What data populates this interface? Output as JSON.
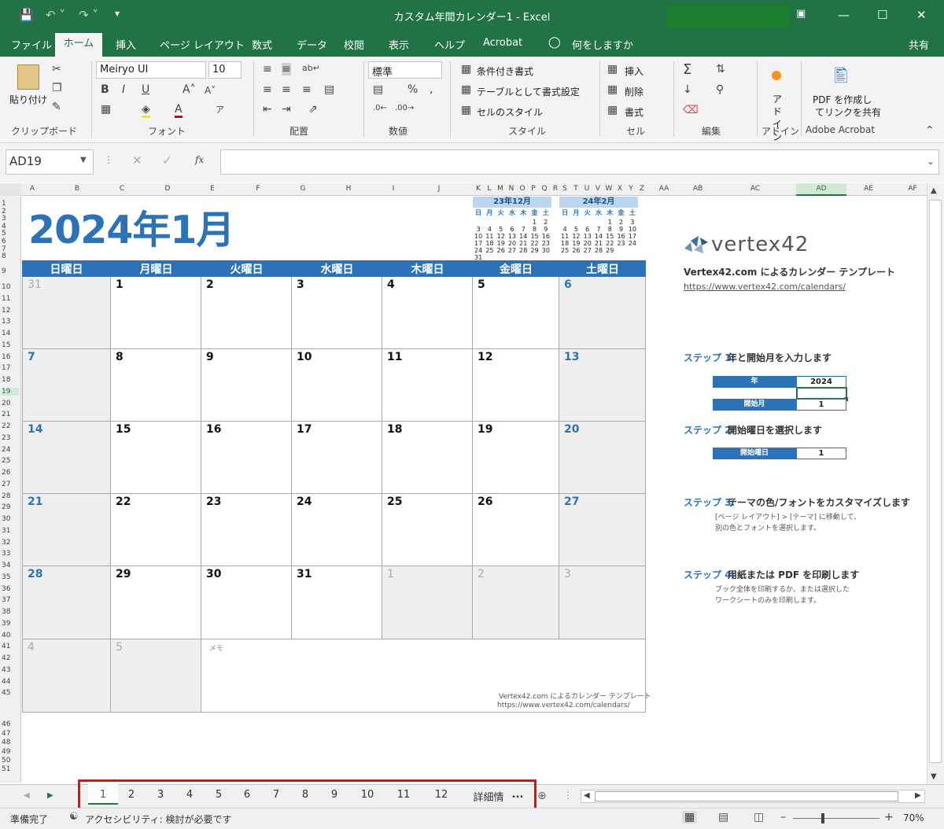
{
  "window": {
    "title": "カスタム年間カレンダー1  -  Excel",
    "quick_access": [
      "save-icon",
      "undo-icon",
      "redo-icon",
      "customize-icon"
    ],
    "controls": [
      "ribbon-display-icon",
      "minimize-icon",
      "maximize-icon",
      "close-icon"
    ]
  },
  "menu": {
    "tabs": [
      "ファイル",
      "ホーム",
      "挿入",
      "ページ レイアウト",
      "数式",
      "データ",
      "校閲",
      "表示",
      "ヘルプ",
      "Acrobat"
    ],
    "tell_me": "何をしますか",
    "share": "共有"
  },
  "ribbon": {
    "clipboard": {
      "paste": "貼り付け",
      "group": "クリップボード"
    },
    "font": {
      "name": "Meiryo UI",
      "size": "10",
      "group": "フォント"
    },
    "alignment": {
      "group": "配置"
    },
    "number": {
      "format": "標準",
      "group": "数値"
    },
    "styles": {
      "conditional": "条件付き書式",
      "table": "テーブルとして書式設定",
      "cell_styles": "セルのスタイル",
      "group": "スタイル"
    },
    "cells": {
      "insert": "挿入",
      "delete": "削除",
      "format": "書式",
      "group": "セル"
    },
    "editing": {
      "group": "編集"
    },
    "addins": {
      "label": "アド\nイン",
      "group": "アドイン"
    },
    "acrobat": {
      "label1": "PDF を作成し",
      "label2": "てリンクを共有",
      "group": "Adobe Acrobat"
    }
  },
  "formula_bar": {
    "name_box": "AD19",
    "fx": "fx",
    "content": ""
  },
  "columns": [
    "A",
    "B",
    "C",
    "D",
    "E",
    "F",
    "G",
    "H",
    "I",
    "J",
    "K",
    "L",
    "M",
    "N",
    "O",
    "P",
    "Q",
    "R",
    "S",
    "T",
    "U",
    "V",
    "W",
    "X",
    "Y",
    "Z",
    "AA",
    "AB",
    "AC",
    "AD",
    "AE",
    "AF"
  ],
  "rows": [
    "1",
    "2",
    "3",
    "4",
    "5",
    "6",
    "7",
    "8",
    "9",
    "10",
    "11",
    "12",
    "13",
    "14",
    "15",
    "16",
    "17",
    "18",
    "19",
    "20",
    "21",
    "22",
    "23",
    "24",
    "25",
    "26",
    "27",
    "28",
    "29",
    "30",
    "31",
    "32",
    "33",
    "34",
    "35",
    "36",
    "37",
    "38",
    "39",
    "40",
    "41",
    "42",
    "43",
    "44",
    "45",
    "46",
    "47",
    "48",
    "49",
    "50",
    "51"
  ],
  "calendar": {
    "title": "2024年1月",
    "weekdays": [
      "日曜日",
      "月曜日",
      "火曜日",
      "水曜日",
      "木曜日",
      "金曜日",
      "土曜日"
    ],
    "weeks": [
      [
        "31",
        "1",
        "2",
        "3",
        "4",
        "5",
        "6"
      ],
      [
        "7",
        "8",
        "9",
        "10",
        "11",
        "12",
        "13"
      ],
      [
        "14",
        "15",
        "16",
        "17",
        "18",
        "19",
        "20"
      ],
      [
        "21",
        "22",
        "23",
        "24",
        "25",
        "26",
        "27"
      ],
      [
        "28",
        "29",
        "30",
        "31",
        "1",
        "2",
        "3"
      ],
      [
        "4",
        "5"
      ]
    ],
    "memo_label": "メモ",
    "footer1": "Vertex42.com によるカレンダー テンプレート",
    "footer2": "https://www.vertex42.com/calendars/"
  },
  "mini_prev": {
    "title": "23年12月",
    "weekdays": [
      "日",
      "月",
      "火",
      "水",
      "木",
      "金",
      "土"
    ],
    "rows": [
      [
        "",
        "",
        "",
        "",
        "",
        "1",
        "2"
      ],
      [
        "3",
        "4",
        "5",
        "6",
        "7",
        "8",
        "9"
      ],
      [
        "10",
        "11",
        "12",
        "13",
        "14",
        "15",
        "16"
      ],
      [
        "17",
        "18",
        "19",
        "20",
        "21",
        "22",
        "23"
      ],
      [
        "24",
        "25",
        "26",
        "27",
        "28",
        "29",
        "30"
      ],
      [
        "31",
        "",
        "",
        "",
        "",
        "",
        ""
      ]
    ]
  },
  "mini_next": {
    "title": "24年2月",
    "weekdays": [
      "日",
      "月",
      "火",
      "水",
      "木",
      "金",
      "土"
    ],
    "rows": [
      [
        "",
        "",
        "",
        "",
        "1",
        "2",
        "3"
      ],
      [
        "4",
        "5",
        "6",
        "7",
        "8",
        "9",
        "10"
      ],
      [
        "11",
        "12",
        "13",
        "14",
        "15",
        "16",
        "17"
      ],
      [
        "18",
        "19",
        "20",
        "21",
        "22",
        "23",
        "24"
      ],
      [
        "25",
        "26",
        "27",
        "28",
        "29",
        "",
        ""
      ]
    ]
  },
  "panel": {
    "logo": "vertex42",
    "heading": "Vertex42.com によるカレンダー テンプレート",
    "link": "https://www.vertex42.com/calendars/",
    "step1": {
      "label": "ステップ 1:",
      "text": "年と開始月を入力します"
    },
    "year_label": "年",
    "year_value": "2024",
    "month_label": "開始月",
    "month_value": "1",
    "step2": {
      "label": "ステップ 2:",
      "text": "開始曜日を選択します"
    },
    "weekday_label": "開始曜日",
    "weekday_value": "1",
    "step3": {
      "label": "ステップ 3:",
      "text": "テーマの色/フォントをカスタマイズします",
      "note1": "[ページ レイアウト] > [テーマ] に移動して、",
      "note2": "別の色とフォントを選択します。"
    },
    "step4": {
      "label": "ステップ 4:",
      "text": "用紙または PDF を印刷します",
      "note1": "ブック全体を印刷するか、または選択した",
      "note2": "ワークシートのみを印刷します。"
    }
  },
  "sheets": [
    "1",
    "2",
    "3",
    "4",
    "5",
    "6",
    "7",
    "8",
    "9",
    "10",
    "11",
    "12",
    "詳細情"
  ],
  "sheets_more": "...",
  "status": {
    "ready": "準備完了",
    "accessibility": "アクセシビリティ: 検討が必要です",
    "zoom": "70%"
  }
}
